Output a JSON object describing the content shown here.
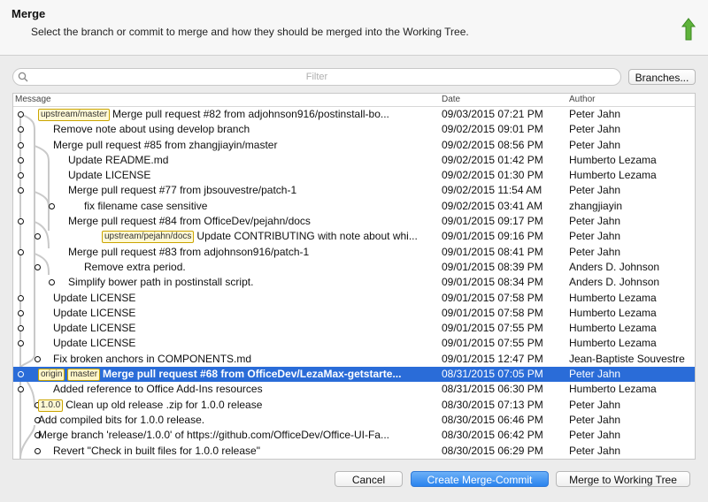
{
  "header": {
    "title": "Merge",
    "subtitle": "Select the branch or commit to merge and how they should be merged into the Working Tree."
  },
  "filter": {
    "placeholder": "Filter"
  },
  "branches_button": "Branches...",
  "columns": {
    "message": "Message",
    "date": "Date",
    "author": "Author"
  },
  "commits": [
    {
      "tag": "upstream/master",
      "message": "Merge pull request #82 from adjohnson916/postinstall-bo...",
      "date": "09/03/2015 07:21 PM",
      "author": "Peter Jahn"
    },
    {
      "message": "Remove note about using develop branch",
      "date": "09/02/2015 09:01 PM",
      "author": "Peter Jahn"
    },
    {
      "message": "Merge pull request #85 from zhangjiayin/master",
      "date": "09/02/2015 08:56 PM",
      "author": "Peter Jahn"
    },
    {
      "message": "Update README.md",
      "date": "09/02/2015 01:42 PM",
      "author": "Humberto Lezama"
    },
    {
      "message": "Update LICENSE",
      "date": "09/02/2015 01:30 PM",
      "author": "Humberto Lezama"
    },
    {
      "message": "Merge pull request #77 from jbsouvestre/patch-1",
      "date": "09/02/2015 11:54 AM",
      "author": "Peter Jahn"
    },
    {
      "message": "fix filename case  sensitive",
      "date": "09/02/2015 03:41 AM",
      "author": "zhangjiayin"
    },
    {
      "message": "Merge pull request #84 from OfficeDev/pejahn/docs",
      "date": "09/01/2015 09:17 PM",
      "author": "Peter Jahn"
    },
    {
      "tag": "upstream/pejahn/docs",
      "message": "Update CONTRIBUTING with note about whi...",
      "date": "09/01/2015 09:16 PM",
      "author": "Peter Jahn"
    },
    {
      "message": "Merge pull request #83 from adjohnson916/patch-1",
      "date": "09/01/2015 08:41 PM",
      "author": "Peter Jahn"
    },
    {
      "message": "Remove extra period.",
      "date": "09/01/2015 08:39 PM",
      "author": "Anders D. Johnson"
    },
    {
      "message": "Simplify bower path in postinstall script.",
      "date": "09/01/2015 08:34 PM",
      "author": "Anders D. Johnson"
    },
    {
      "message": "Update LICENSE",
      "date": "09/01/2015 07:58 PM",
      "author": "Humberto Lezama"
    },
    {
      "message": "Update LICENSE",
      "date": "09/01/2015 07:58 PM",
      "author": "Humberto Lezama"
    },
    {
      "message": "Update LICENSE",
      "date": "09/01/2015 07:55 PM",
      "author": "Humberto Lezama"
    },
    {
      "message": "Update LICENSE",
      "date": "09/01/2015 07:55 PM",
      "author": "Humberto Lezama"
    },
    {
      "message": "Fix broken anchors in COMPONENTS.md",
      "date": "09/01/2015 12:47 PM",
      "author": "Jean-Baptiste Souvestre"
    },
    {
      "tag": "origin",
      "tag2": "master",
      "message": "Merge pull request #68 from OfficeDev/LezaMax-getstarte...",
      "date": "08/31/2015 07:05 PM",
      "author": "Peter Jahn",
      "selected": true
    },
    {
      "message": "Added reference to Office Add-Ins resources",
      "date": "08/31/2015 06:30 PM",
      "author": "Humberto Lezama"
    },
    {
      "tag": "1.0.0",
      "message": "Clean up old release .zip for 1.0.0 release",
      "date": "08/30/2015 07:13 PM",
      "author": "Peter Jahn"
    },
    {
      "message": "Add compiled bits for 1.0.0 release.",
      "date": "08/30/2015 06:46 PM",
      "author": "Peter Jahn"
    },
    {
      "message": "Merge branch 'release/1.0.0' of https://github.com/OfficeDev/Office-UI-Fa...",
      "date": "08/30/2015 06:42 PM",
      "author": "Peter Jahn"
    },
    {
      "message": "Revert \"Check in built files for 1.0.0 release\"",
      "date": "08/30/2015 06:29 PM",
      "author": "Peter Jahn"
    }
  ],
  "buttons": {
    "cancel": "Cancel",
    "create": "Create Merge-Commit",
    "merge": "Merge to Working Tree"
  },
  "colors": {
    "accent": "#2a83ee",
    "selection": "#2a6cd8",
    "tag_border": "#caa400",
    "tag_bg": "#fff9d6",
    "arrow": "#5fb33b"
  }
}
